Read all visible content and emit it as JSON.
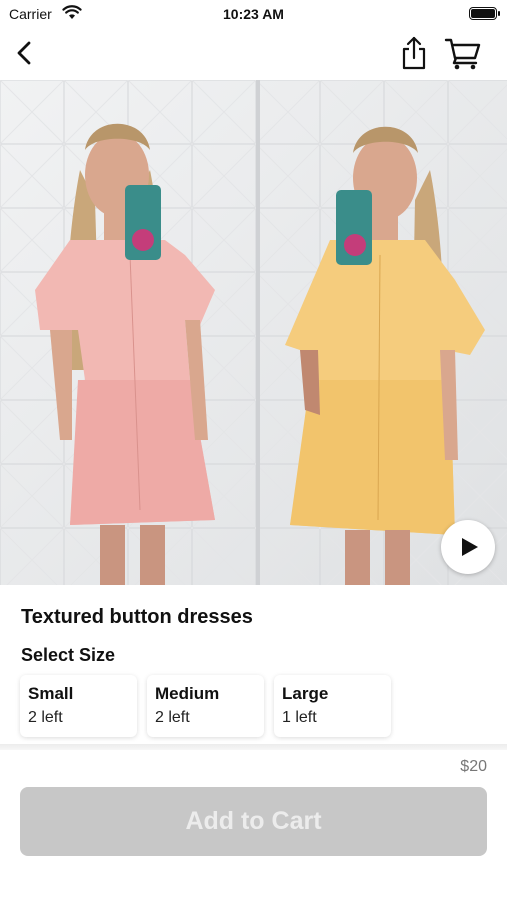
{
  "status_bar": {
    "carrier": "Carrier",
    "time": "10:23 AM"
  },
  "nav": {
    "icons": [
      "back-chevron-icon",
      "share-icon",
      "cart-icon"
    ]
  },
  "product": {
    "title": "Textured button dresses",
    "price": "$20",
    "image": {
      "description_colors": {
        "pink_dress": "#f2b8b3",
        "yellow_dress": "#f5cc7d"
      },
      "has_video": true
    }
  },
  "sizes": {
    "heading": "Select Size",
    "options": [
      {
        "name": "Small",
        "stock": "2 left"
      },
      {
        "name": "Medium",
        "stock": "2 left"
      },
      {
        "name": "Large",
        "stock": "1 left"
      }
    ]
  },
  "cta": {
    "label": "Add to Cart",
    "disabled_color": "#c7c7c7"
  }
}
